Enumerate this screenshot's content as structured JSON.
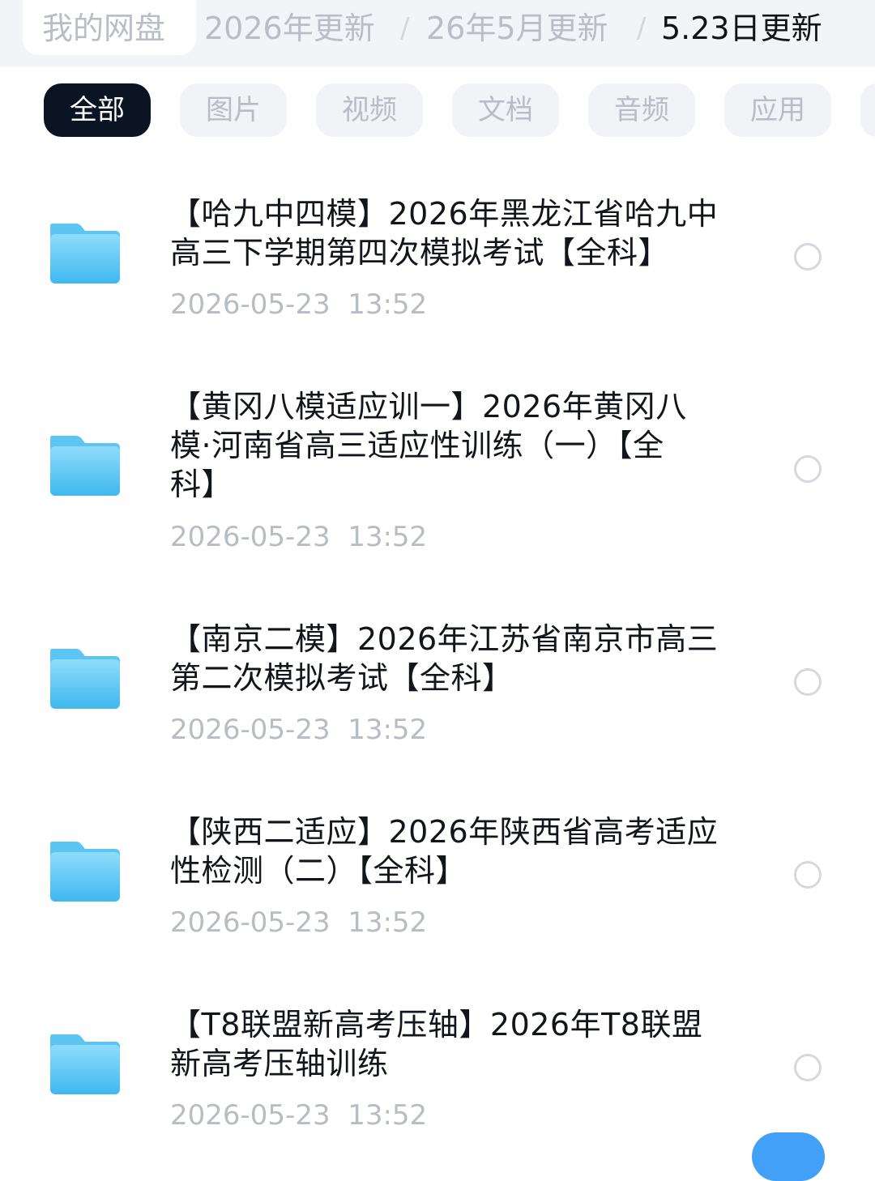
{
  "breadcrumb": {
    "home": "我的网盘",
    "items": [
      "2026年更新",
      "26年5月更新",
      "5.23日更新"
    ],
    "separator": "/"
  },
  "tabs": [
    "全部",
    "图片",
    "视频",
    "文档",
    "音频",
    "应用"
  ],
  "active_tab": "全部",
  "files": [
    {
      "line1": "【哈九中四模】2026年黑龙江省哈九中",
      "line2": "高三下学期第四次模拟考试【全科】",
      "date": "2026-05-23  13:52"
    },
    {
      "line1": "【黄冈八模适应训一】2026年黄冈八",
      "line2": "模·河南省高三适应性训练（一）【全",
      "line3": "科】",
      "date": "2026-05-23  13:52"
    },
    {
      "line1": "【南京二模】2026年江苏省南京市高三",
      "line2": "第二次模拟考试【全科】",
      "date": "2026-05-23  13:52"
    },
    {
      "line1": "【陕西二适应】2026年陕西省高考适应",
      "line2": "性检测（二）【全科】",
      "date": "2026-05-23  13:52"
    },
    {
      "line1": "【T8联盟新高考压轴】2026年T8联盟",
      "line2": "新高考压轴训练",
      "date": "2026-05-23  13:52"
    }
  ],
  "icons": {
    "folder": "folder-icon",
    "select": "radio-circle-icon"
  },
  "colors": {
    "folder_top": "#8fdcfb",
    "folder_bottom": "#3fb8ef",
    "active_tab_bg": "#0b1423",
    "fab": "#43a0f8"
  }
}
